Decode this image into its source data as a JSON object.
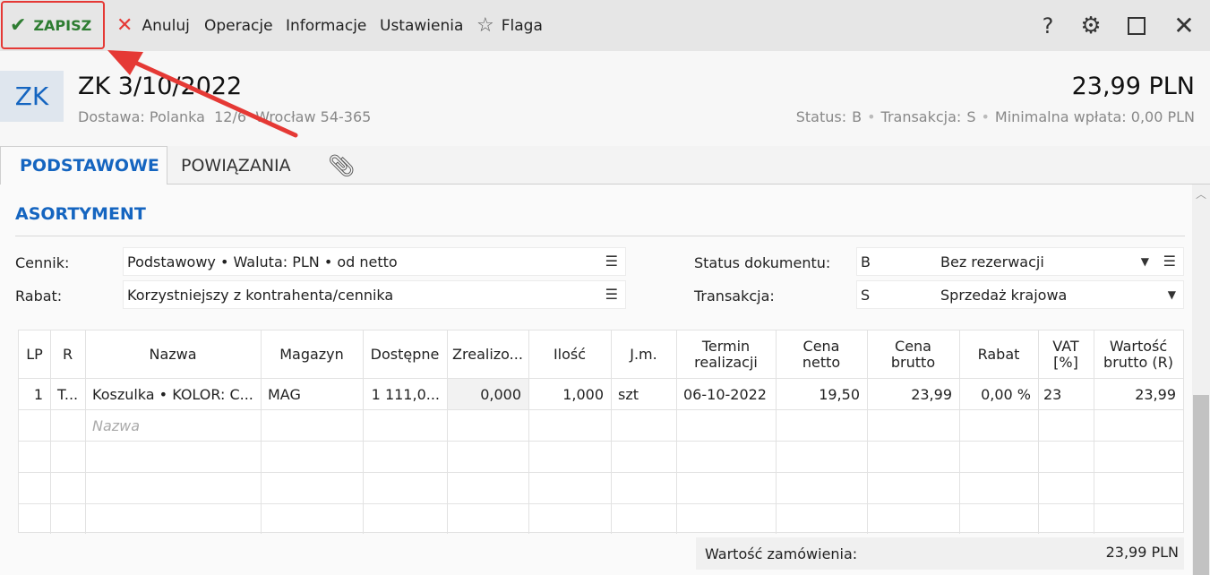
{
  "toolbar": {
    "save": "ZAPISZ",
    "cancel": "Anuluj",
    "operations": "Operacje",
    "information": "Informacje",
    "settings": "Ustawienia",
    "flag": "Flaga",
    "help": "?"
  },
  "header": {
    "badge": "ZK",
    "title": "ZK 3/10/2022",
    "subtitle": "Dostawa: Polanka  12/6  Wrocław 54-365",
    "amount": "23,99 PLN",
    "status_label": "Status:",
    "status_value": "B",
    "transaction_label": "Transakcja:",
    "transaction_value": "S",
    "min_payment": "Minimalna wpłata: 0,00 PLN"
  },
  "tabs": {
    "basic": "PODSTAWOWE",
    "related": "POWIĄZANIA"
  },
  "section": {
    "title": "ASORTYMENT"
  },
  "form": {
    "pricelist_label": "Cennik:",
    "pricelist_value": "Podstawowy • Waluta: PLN • od netto",
    "discount_label": "Rabat:",
    "discount_value": "Korzystniejszy z kontrahenta/cennika",
    "doc_status_label": "Status dokumentu:",
    "doc_status_code": "B",
    "doc_status_text": "Bez rezerwacji",
    "transaction_label": "Transakcja:",
    "transaction_code": "S",
    "transaction_text": "Sprzedaż krajowa"
  },
  "table": {
    "headers": {
      "lp": "LP",
      "r": "R",
      "name": "Nazwa",
      "warehouse": "Magazyn",
      "available": "Dostępne",
      "realized": "Zrealizo...",
      "qty": "Ilość",
      "unit": "J.m.",
      "term_1": "Termin",
      "term_2": "realizacji",
      "net_1": "Cena",
      "net_2": "netto",
      "gross_1": "Cena",
      "gross_2": "brutto",
      "discount": "Rabat",
      "vat_1": "VAT",
      "vat_2": "[%]",
      "value_1": "Wartość",
      "value_2": "brutto (R)"
    },
    "row1": {
      "lp": "1",
      "r": "T...",
      "name": "Koszulka • KOLOR: C...",
      "warehouse": "MAG",
      "available": "1 111,0...",
      "realized": "0,000",
      "qty": "1,000",
      "unit": "szt",
      "term": "06-10-2022",
      "net": "19,50",
      "gross": "23,99",
      "discount": "0,00 %",
      "vat": "23",
      "value": "23,99"
    },
    "name_placeholder": "Nazwa"
  },
  "total": {
    "label": "Wartość zamówienia:",
    "value": "23,99 PLN"
  },
  "colors": {
    "accent": "#1565c0",
    "save": "#2e7d32",
    "cancel": "#e53935",
    "annotation": "#e53935"
  }
}
